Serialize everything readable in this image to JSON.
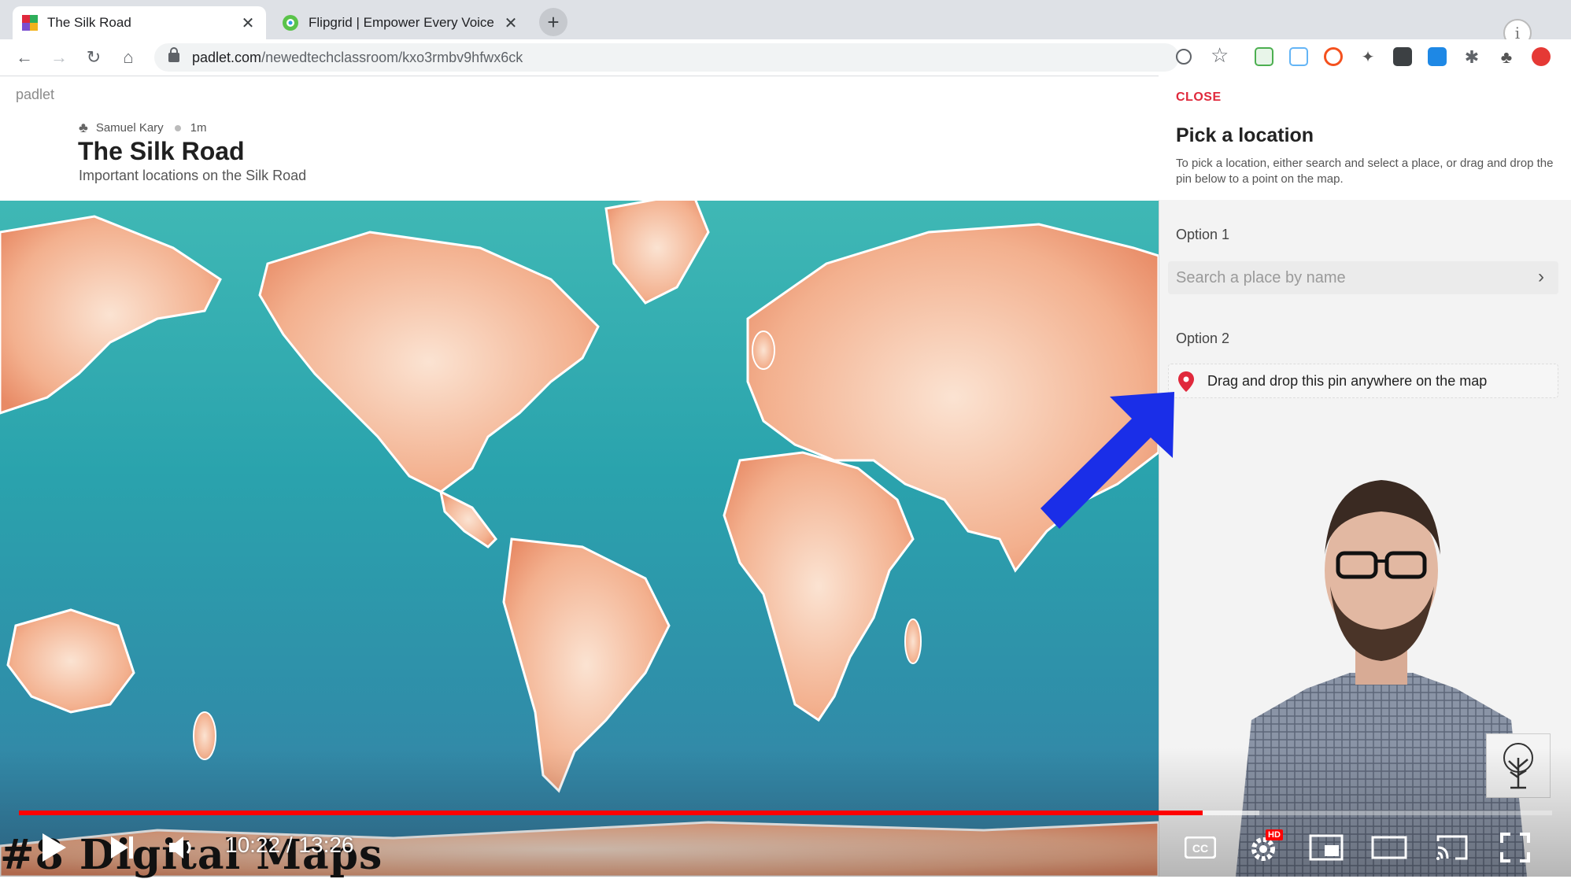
{
  "browser": {
    "tabs": [
      {
        "title": "The Silk Road",
        "active": true
      },
      {
        "title": "Flipgrid | Empower Every Voice",
        "active": false
      }
    ],
    "new_tab_label": "+",
    "url_domain": "padlet.com",
    "url_path": "/newedtechclassroom/kxo3rmbv9hfwx6ck"
  },
  "padlet": {
    "logo": "padlet",
    "author": "Samuel Kary",
    "time": "1m",
    "title": "The Silk Road",
    "subtitle": "Important locations on the Silk Road"
  },
  "panel": {
    "close_label": "CLOSE",
    "title": "Pick a location",
    "description": "To pick a location, either search and select a place, or drag and drop the pin below to a point on the map.",
    "option1_label": "Option 1",
    "search_placeholder": "Search a place by name",
    "option2_label": "Option 2",
    "drag_text": "Drag and drop this pin anywhere on the map"
  },
  "video": {
    "current_time": "10:22",
    "separator": " / ",
    "duration": "13:26",
    "watermark": "#8 Digital Maps",
    "played_fraction": 0.772,
    "buffered_fraction": 0.809,
    "hd_badge": "HD"
  },
  "colors": {
    "accent_red": "#e0293c",
    "arrow_blue": "#1a2ee8",
    "progress_red": "#ff0000"
  }
}
